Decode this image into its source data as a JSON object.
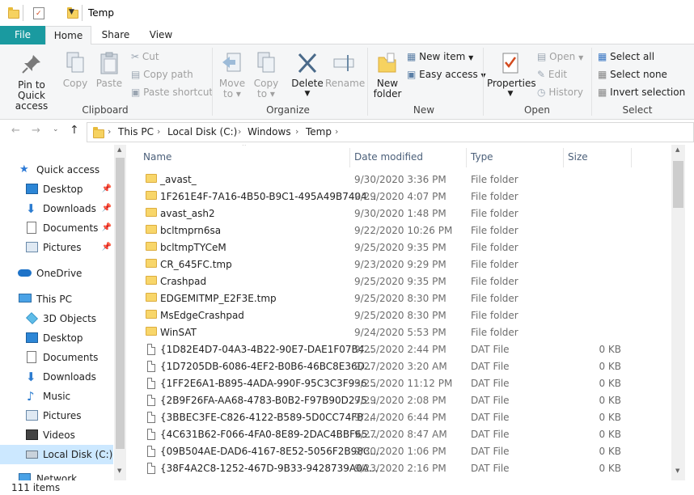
{
  "window": {
    "title": "Temp"
  },
  "tabs": [
    {
      "label": "File"
    },
    {
      "label": "Home"
    },
    {
      "label": "Share"
    },
    {
      "label": "View"
    }
  ],
  "ribbon": {
    "clipboard": {
      "label": "Clipboard",
      "pin": "Pin to Quick access",
      "pin_l1": "Pin to Quick",
      "pin_l2": "access",
      "copy": "Copy",
      "paste": "Paste",
      "cut": "Cut",
      "copy_path": "Copy path",
      "paste_shortcut": "Paste shortcut"
    },
    "organize": {
      "label": "Organize",
      "move_to_l1": "Move",
      "move_to_l2": "to",
      "copy_to_l1": "Copy",
      "copy_to_l2": "to",
      "delete": "Delete",
      "rename": "Rename"
    },
    "new": {
      "label": "New",
      "new_folder_l1": "New",
      "new_folder_l2": "folder",
      "new_item": "New item",
      "easy_access": "Easy access"
    },
    "open": {
      "label": "Open",
      "properties": "Properties",
      "open": "Open",
      "edit": "Edit",
      "history": "History"
    },
    "select": {
      "label": "Select",
      "select_all": "Select all",
      "select_none": "Select none",
      "invert": "Invert selection"
    }
  },
  "breadcrumb": [
    "This PC",
    "Local Disk (C:)",
    "Windows",
    "Temp"
  ],
  "nav": {
    "quick_access": "Quick access",
    "qa_items": [
      "Desktop",
      "Downloads",
      "Documents",
      "Pictures"
    ],
    "onedrive": "OneDrive",
    "this_pc": "This PC",
    "pc_items": [
      "3D Objects",
      "Desktop",
      "Documents",
      "Downloads",
      "Music",
      "Pictures",
      "Videos",
      "Local Disk (C:)"
    ],
    "network": "Network"
  },
  "columns": {
    "name": "Name",
    "date": "Date modified",
    "type": "Type",
    "size": "Size"
  },
  "files": [
    {
      "name": "_avast_",
      "date": "9/30/2020 3:36 PM",
      "type": "File folder",
      "size": "",
      "kind": "folder"
    },
    {
      "name": "1F261E4F-7A16-4B50-B9C1-495A49B7404...",
      "date": "9/29/2020 4:07 PM",
      "type": "File folder",
      "size": "",
      "kind": "folder"
    },
    {
      "name": "avast_ash2",
      "date": "9/30/2020 1:48 PM",
      "type": "File folder",
      "size": "",
      "kind": "folder"
    },
    {
      "name": "bcltmprn6sa",
      "date": "9/22/2020 10:26 PM",
      "type": "File folder",
      "size": "",
      "kind": "folder"
    },
    {
      "name": "bcltmpTYCeM",
      "date": "9/25/2020 9:35 PM",
      "type": "File folder",
      "size": "",
      "kind": "folder"
    },
    {
      "name": "CR_645FC.tmp",
      "date": "9/23/2020 9:29 PM",
      "type": "File folder",
      "size": "",
      "kind": "folder"
    },
    {
      "name": "Crashpad",
      "date": "9/25/2020 9:35 PM",
      "type": "File folder",
      "size": "",
      "kind": "folder"
    },
    {
      "name": "EDGEMITMP_E2F3E.tmp",
      "date": "9/25/2020 8:30 PM",
      "type": "File folder",
      "size": "",
      "kind": "folder"
    },
    {
      "name": "MsEdgeCrashpad",
      "date": "9/25/2020 8:30 PM",
      "type": "File folder",
      "size": "",
      "kind": "folder"
    },
    {
      "name": "WinSAT",
      "date": "9/24/2020 5:53 PM",
      "type": "File folder",
      "size": "",
      "kind": "folder"
    },
    {
      "name": "{1D82E4D7-04A3-4B22-90E7-DAE1F07B4...",
      "date": "9/25/2020 2:44 PM",
      "type": "DAT File",
      "size": "0 KB",
      "kind": "file"
    },
    {
      "name": "{1D7205DB-6086-4EF2-B0B6-46BC8E36D...",
      "date": "9/27/2020 3:20 AM",
      "type": "DAT File",
      "size": "0 KB",
      "kind": "file"
    },
    {
      "name": "{1FF2E6A1-B895-4ADA-990F-95C3C3F936...",
      "date": "9/25/2020 11:12 PM",
      "type": "DAT File",
      "size": "0 KB",
      "kind": "file"
    },
    {
      "name": "{2B9F26FA-AA68-4783-B0B2-F97B90D275...",
      "date": "9/29/2020 2:08 PM",
      "type": "DAT File",
      "size": "0 KB",
      "kind": "file"
    },
    {
      "name": "{3BBEC3FE-C826-4122-B589-5D0CC74FB...",
      "date": "9/24/2020 6:44 PM",
      "type": "DAT File",
      "size": "0 KB",
      "kind": "file"
    },
    {
      "name": "{4C631B62-F066-4FA0-8E89-2DAC4BBF65...",
      "date": "9/27/2020 8:47 AM",
      "type": "DAT File",
      "size": "0 KB",
      "kind": "file"
    },
    {
      "name": "{09B504AE-DAD6-4167-8E52-5056F2B98C...",
      "date": "9/30/2020 1:06 PM",
      "type": "DAT File",
      "size": "0 KB",
      "kind": "file"
    },
    {
      "name": "{38F4A2C8-1252-467D-9B33-9428739A0A...",
      "date": "9/23/2020 2:16 PM",
      "type": "DAT File",
      "size": "0 KB",
      "kind": "file"
    }
  ],
  "status": {
    "count": "111 items"
  }
}
